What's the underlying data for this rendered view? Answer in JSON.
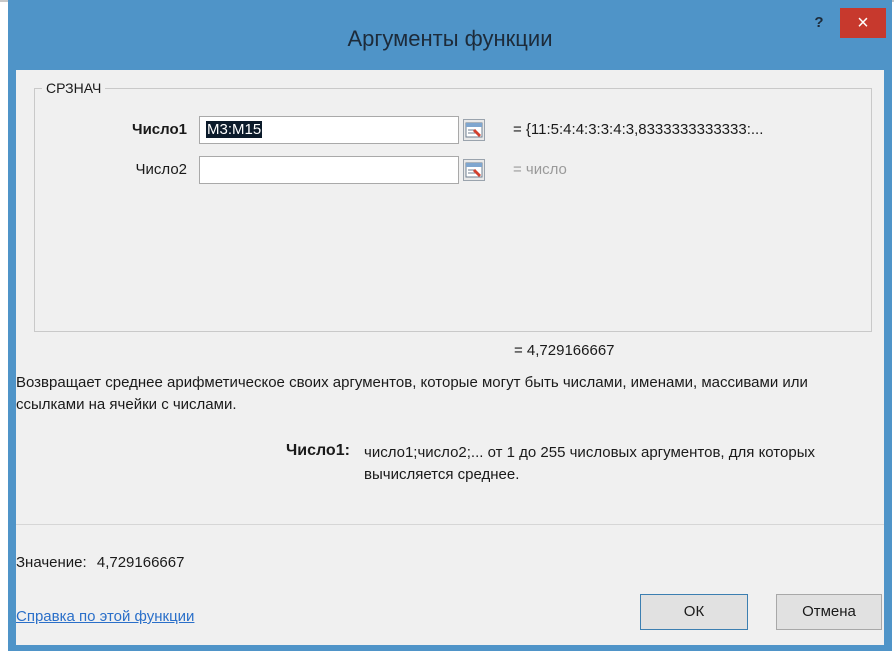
{
  "dialog": {
    "title": "Аргументы функции",
    "help_label": "?",
    "close_label": "×"
  },
  "function": {
    "name": "СРЗНАЧ",
    "arguments": [
      {
        "label": "Число1",
        "value": "M3:M15",
        "result": "= {11:5:4:4:3:3:4:3,8333333333333:...",
        "bold": true
      },
      {
        "label": "Число2",
        "value": "",
        "result": "= число",
        "bold": false
      }
    ],
    "total_result": "= 4,729166667",
    "description": "Возвращает среднее арифметическое своих аргументов, которые могут быть числами, именами, массивами или ссылками на ячейки с числами.",
    "param_name": "Число1:",
    "param_description": "число1;число2;... от 1 до 255 числовых аргументов, для которых вычисляется среднее."
  },
  "footer": {
    "value_label": "Значение:",
    "value": "4,729166667",
    "help_link": "Справка по этой функции",
    "ok_label": "ОК",
    "cancel_label": "Отмена"
  },
  "colors": {
    "frame": "#4f94c8",
    "close": "#c7392d",
    "link": "#2a6fc9"
  }
}
